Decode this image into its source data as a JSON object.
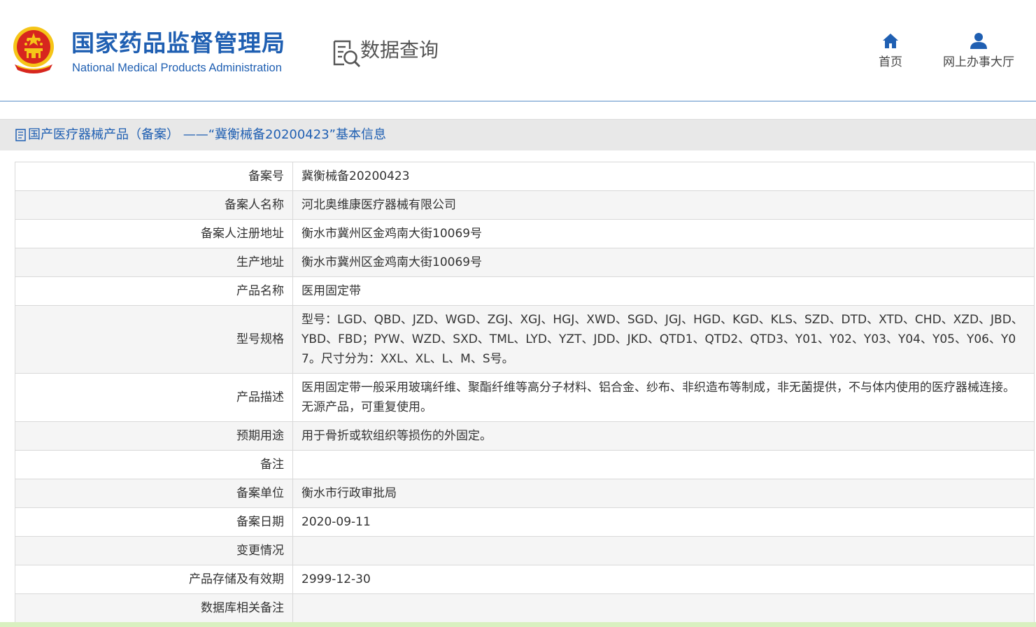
{
  "header": {
    "logo_cn": "国家药品监督管理局",
    "logo_en": "National Medical Products Administration",
    "query_label": "数据查询",
    "nav": {
      "home_label": "首页",
      "hall_label": "网上办事大厅"
    }
  },
  "section": {
    "title": "国产医疗器械产品（备案） ——“冀衡械备20200423”基本信息"
  },
  "rows": [
    {
      "label": "备案号",
      "value": "冀衡械备20200423"
    },
    {
      "label": "备案人名称",
      "value": "河北奥维康医疗器械有限公司"
    },
    {
      "label": "备案人注册地址",
      "value": "衡水市冀州区金鸡南大街10069号"
    },
    {
      "label": "生产地址",
      "value": "衡水市冀州区金鸡南大街10069号"
    },
    {
      "label": "产品名称",
      "value": "医用固定带"
    },
    {
      "label": "型号规格",
      "value": "型号：LGD、QBD、JZD、WGD、ZGJ、XGJ、HGJ、XWD、SGD、JGJ、HGD、KGD、KLS、SZD、DTD、XTD、CHD、XZD、JBD、YBD、FBD；PYW、WZD、SXD、TML、LYD、YZT、JDD、JKD、QTD1、QTD2、QTD3、Y01、Y02、Y03、Y04、Y05、Y06、Y07。尺寸分为：XXL、XL、L、M、S号。"
    },
    {
      "label": "产品描述",
      "value": "医用固定带一般采用玻璃纤维、聚酯纤维等高分子材料、铝合金、纱布、非织造布等制成，非无菌提供，不与体内使用的医疗器械连接。无源产品，可重复使用。"
    },
    {
      "label": "预期用途",
      "value": "用于骨折或软组织等损伤的外固定。"
    },
    {
      "label": "备注",
      "value": ""
    },
    {
      "label": "备案单位",
      "value": "衡水市行政审批局"
    },
    {
      "label": "备案日期",
      "value": "2020-09-11"
    },
    {
      "label": "变更情况",
      "value": ""
    },
    {
      "label": "产品存储及有效期",
      "value": "2999-12-30"
    },
    {
      "label": "数据库相关备注",
      "value": ""
    }
  ],
  "colors": {
    "brand_blue": "#1f5fb2",
    "emblem_red": "#d7261e",
    "emblem_gold": "#f5c518"
  }
}
